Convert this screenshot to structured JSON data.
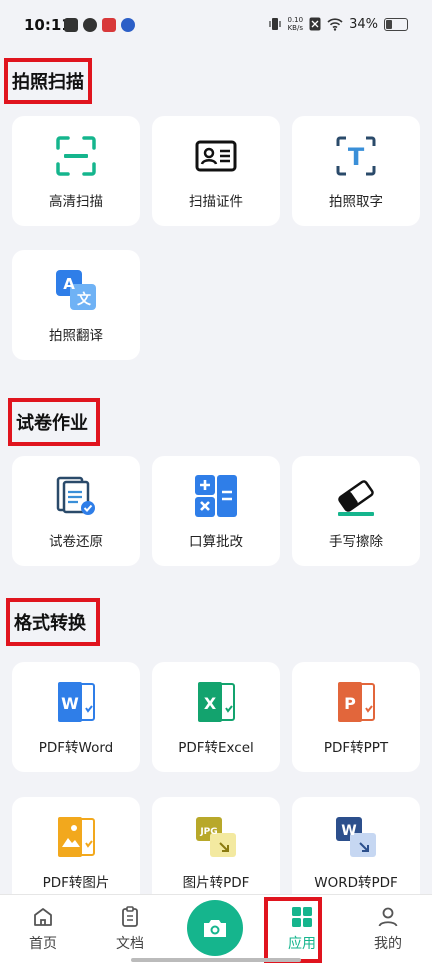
{
  "status_bar": {
    "time": "10:11",
    "net_speed_value": "0.10",
    "net_speed_unit": "KB/s",
    "battery": "34%",
    "battery_level": 0.34
  },
  "sections": [
    {
      "title": "拍照扫描",
      "items": [
        "高清扫描",
        "扫描证件",
        "拍照取字",
        "拍照翻译"
      ]
    },
    {
      "title": "试卷作业",
      "items": [
        "试卷还原",
        "口算批改",
        "手写擦除"
      ]
    },
    {
      "title": "格式转换",
      "items": [
        "PDF转Word",
        "PDF转Excel",
        "PDF转PPT",
        "PDF转图片",
        "图片转PDF",
        "WORD转PDF"
      ]
    }
  ],
  "icons": {
    "excel_letter": "X",
    "word_letter": "W",
    "ppt_letter": "P",
    "jpg_label": "JPG",
    "text_letter": "T",
    "translate_a": "A",
    "translate_zh": "文"
  },
  "nav": {
    "home": "首页",
    "docs": "文档",
    "apps": "应用",
    "mine": "我的"
  },
  "colors": {
    "accent": "#15b58d",
    "highlight_box": "#e0141e"
  }
}
